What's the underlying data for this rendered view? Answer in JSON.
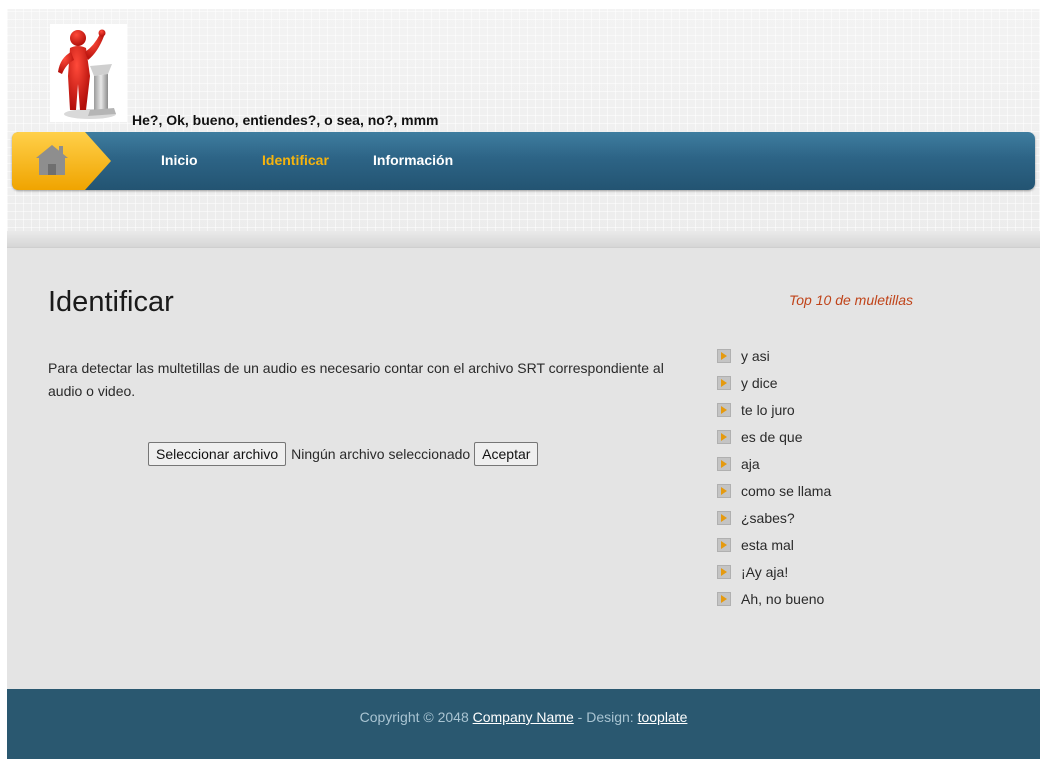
{
  "header": {
    "tagline": "He?, Ok, bueno, entiendes?, o sea, no?, mmm"
  },
  "nav": {
    "items": [
      {
        "label": "Inicio"
      },
      {
        "label": "Identificar"
      },
      {
        "label": "Información"
      }
    ],
    "active_color": "#f6b40e"
  },
  "main": {
    "title": "Identificar",
    "description": "Para detectar las multetillas de un audio es necesario contar con el archivo SRT correspondiente al audio o video.",
    "file_button_label": "Seleccionar archivo",
    "file_status": "Ningún archivo seleccionado",
    "submit_label": "Aceptar"
  },
  "sidebar": {
    "title": "Top 10 de muletillas",
    "items": [
      {
        "label": "y asi"
      },
      {
        "label": "y dice"
      },
      {
        "label": "te lo juro"
      },
      {
        "label": "es de que"
      },
      {
        "label": "aja"
      },
      {
        "label": "como se llama"
      },
      {
        "label": "¿sabes?"
      },
      {
        "label": "esta mal"
      },
      {
        "label": "¡Ay aja!"
      },
      {
        "label": "Ah, no bueno"
      }
    ]
  },
  "footer": {
    "copyright_prefix": "Copyright © 2048",
    "company_link": "Company Name",
    "design_label": "- Design:",
    "design_link": "tooplate"
  },
  "colors": {
    "nav_blue": "#2d6486",
    "footer_blue": "#2a5870",
    "accent_orange": "#c0441a",
    "home_yellow": "#f6b40e"
  }
}
